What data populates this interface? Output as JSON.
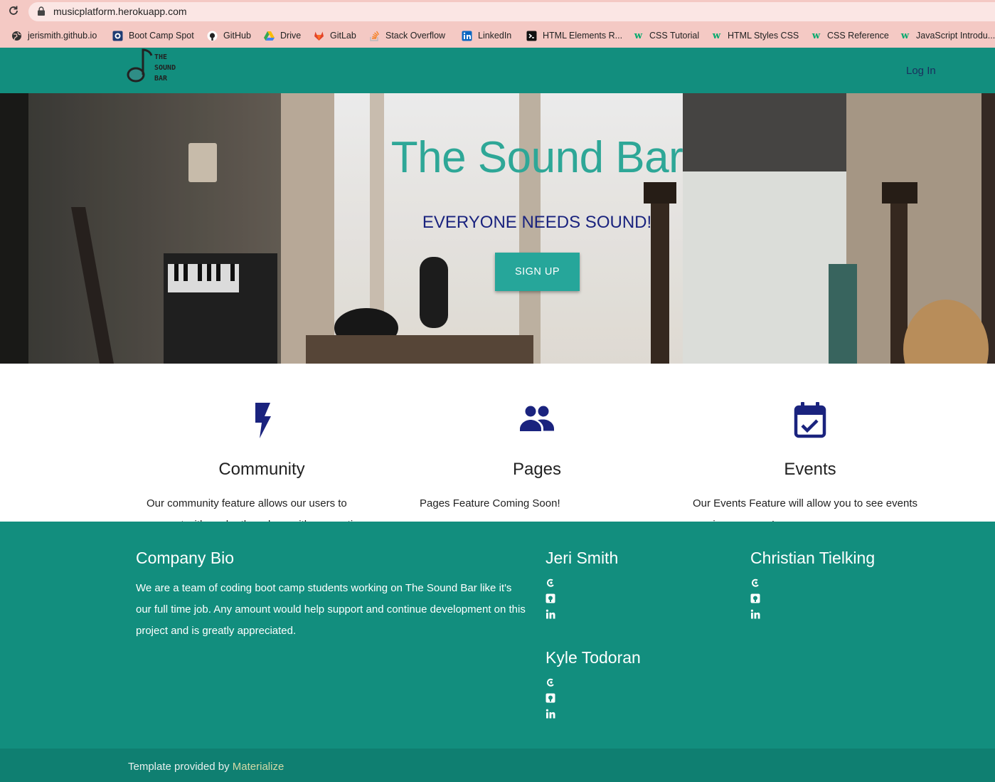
{
  "browser": {
    "url": "musicplatform.herokuapp.com",
    "bookmarks": [
      {
        "label": "jerismith.github.io",
        "icon": "globe-icon"
      },
      {
        "label": "Boot Camp Spot",
        "icon": "bootcamp-icon"
      },
      {
        "label": "GitHub",
        "icon": "github-icon"
      },
      {
        "label": "Drive",
        "icon": "drive-icon"
      },
      {
        "label": "GitLab",
        "icon": "gitlab-icon"
      },
      {
        "label": "Stack Overflow",
        "icon": "stackoverflow-icon"
      },
      {
        "label": "LinkedIn",
        "icon": "linkedin-icon"
      },
      {
        "label": "HTML Elements R...",
        "icon": "devdocs-icon"
      },
      {
        "label": "CSS Tutorial",
        "icon": "w3schools-icon"
      },
      {
        "label": "HTML Styles CSS",
        "icon": "w3schools-icon"
      },
      {
        "label": "CSS Reference",
        "icon": "w3schools-icon"
      },
      {
        "label": "JavaScript Introdu...",
        "icon": "w3schools-icon"
      }
    ]
  },
  "nav": {
    "logo_lines": [
      "THE",
      "SOUND",
      "BAR"
    ],
    "login_label": "Log In",
    "color": "#128e7e"
  },
  "hero": {
    "title": "The Sound Bar",
    "subtitle": "EVERYONE NEEDS SOUND!",
    "signup_label": "SIGN UP",
    "title_color": "#2ea797",
    "subtitle_color": "#1a237e"
  },
  "features": [
    {
      "icon": "lightning-bolt-icon",
      "title": "Community",
      "text": "Our community feature allows our users to connect with each other along with connecting"
    },
    {
      "icon": "people-icon",
      "title": "Pages",
      "text": "Pages Feature Coming Soon!"
    },
    {
      "icon": "calendar-check-icon",
      "title": "Events",
      "text": "Our Events Feature will allow you to see events coming near you!"
    }
  ],
  "footer": {
    "bio_title": "Company Bio",
    "bio_text": "We are a team of coding boot camp students working on The Sound Bar like it's our full time job. Any amount would help support and continue development on this project and is greatly appreciated.",
    "members": [
      {
        "name": "Jeri Smith",
        "links": [
          "mailchimp-icon",
          "github-icon",
          "linkedin-icon"
        ]
      },
      {
        "name": "Christian Tielking",
        "links": [
          "mailchimp-icon",
          "github-icon",
          "linkedin-icon"
        ]
      },
      {
        "name": "Kyle Todoran",
        "links": [
          "mailchimp-icon",
          "github-icon",
          "linkedin-icon"
        ]
      }
    ],
    "credit_prefix": "Template provided by",
    "credit_link": "Materialize"
  }
}
